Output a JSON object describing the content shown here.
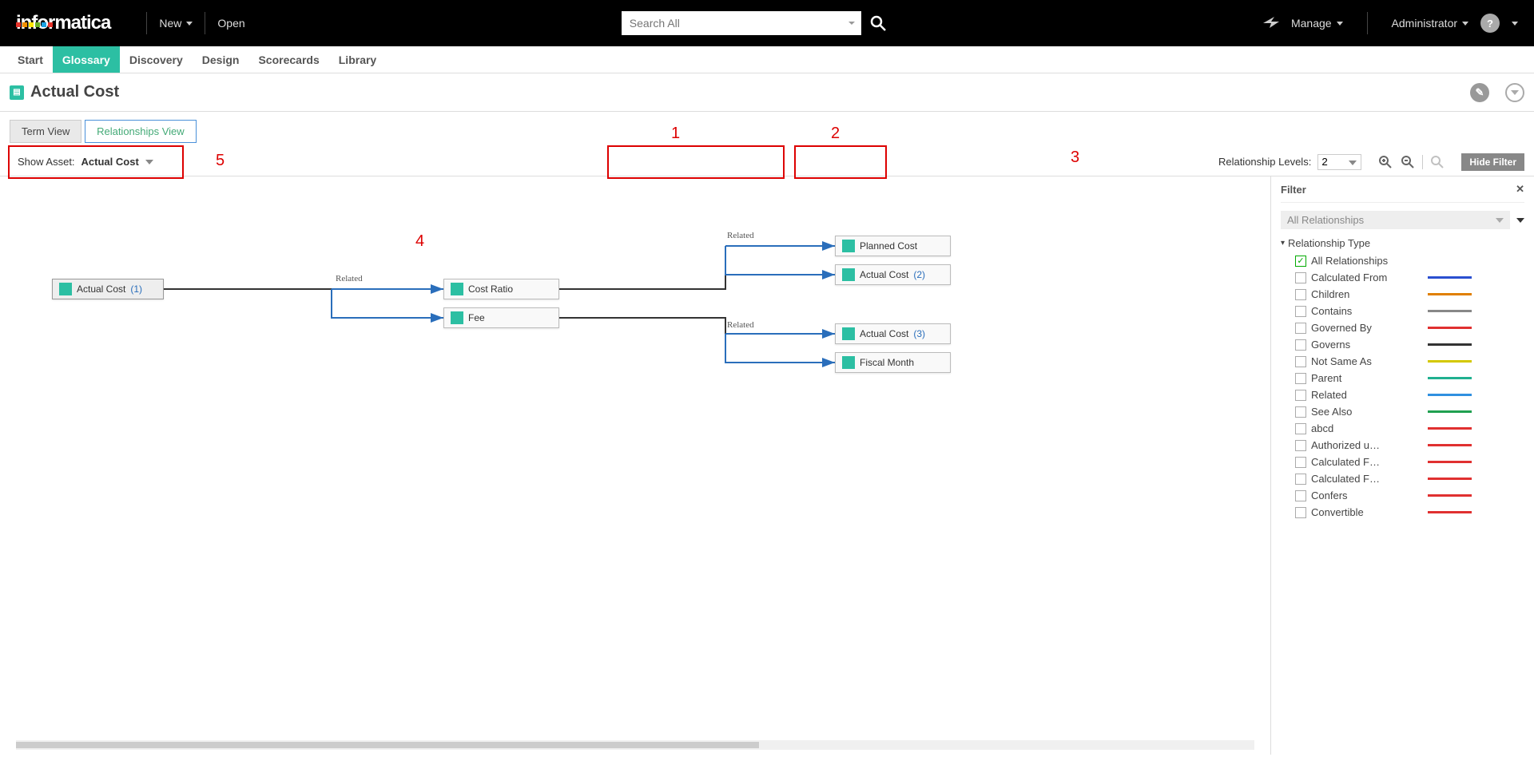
{
  "topbar": {
    "logo_text": "informatica",
    "new_label": "New",
    "open_label": "Open",
    "search_placeholder": "Search All",
    "manage_label": "Manage",
    "user_label": "Administrator"
  },
  "tabs": {
    "start": "Start",
    "glossary": "Glossary",
    "discovery": "Discovery",
    "design": "Design",
    "scorecards": "Scorecards",
    "library": "Library"
  },
  "page": {
    "title": "Actual Cost",
    "term_view": "Term View",
    "relationships_view": "Relationships View",
    "show_asset_label": "Show Asset:",
    "show_asset_value": "Actual Cost",
    "relationship_levels_label": "Relationship Levels:",
    "relationship_levels_value": "2",
    "hide_filter_label": "Hide Filter"
  },
  "nodes": {
    "root": {
      "label": "Actual Cost",
      "count": "(1)"
    },
    "cost_ratio": {
      "label": "Cost Ratio"
    },
    "fee": {
      "label": "Fee"
    },
    "planned_cost": {
      "label": "Planned Cost"
    },
    "actual_cost_2": {
      "label": "Actual Cost",
      "count": "(2)"
    },
    "actual_cost_3": {
      "label": "Actual Cost",
      "count": "(3)"
    },
    "fiscal_month": {
      "label": "Fiscal Month"
    }
  },
  "edge_labels": {
    "related_1": "Related",
    "related_2": "Related",
    "related_3": "Related"
  },
  "filter": {
    "title": "Filter",
    "dropdown": "All Relationships",
    "section_head": "Relationship Type",
    "rows": [
      {
        "label": "All Relationships",
        "checked": true,
        "color": null
      },
      {
        "label": "Calculated From",
        "checked": false,
        "color": "#2a4fd0"
      },
      {
        "label": "Children",
        "checked": false,
        "color": "#e08000"
      },
      {
        "label": "Contains",
        "checked": false,
        "color": "#888"
      },
      {
        "label": "Governed By",
        "checked": false,
        "color": "#e03030"
      },
      {
        "label": "Governs",
        "checked": false,
        "color": "#333"
      },
      {
        "label": "Not Same As",
        "checked": false,
        "color": "#d4c800"
      },
      {
        "label": "Parent",
        "checked": false,
        "color": "#20b090"
      },
      {
        "label": "Related",
        "checked": false,
        "color": "#3090e0"
      },
      {
        "label": "See Also",
        "checked": false,
        "color": "#20a050"
      },
      {
        "label": "abcd",
        "checked": false,
        "color": "#e03030"
      },
      {
        "label": "Authorized u…",
        "checked": false,
        "color": "#e03030"
      },
      {
        "label": "Calculated F…",
        "checked": false,
        "color": "#e03030"
      },
      {
        "label": "Calculated F…",
        "checked": false,
        "color": "#e03030"
      },
      {
        "label": "Confers",
        "checked": false,
        "color": "#e03030"
      },
      {
        "label": "Convertible",
        "checked": false,
        "color": "#e03030"
      }
    ]
  },
  "callouts": {
    "one": "1",
    "two": "2",
    "three": "3",
    "four": "4",
    "five": "5"
  }
}
